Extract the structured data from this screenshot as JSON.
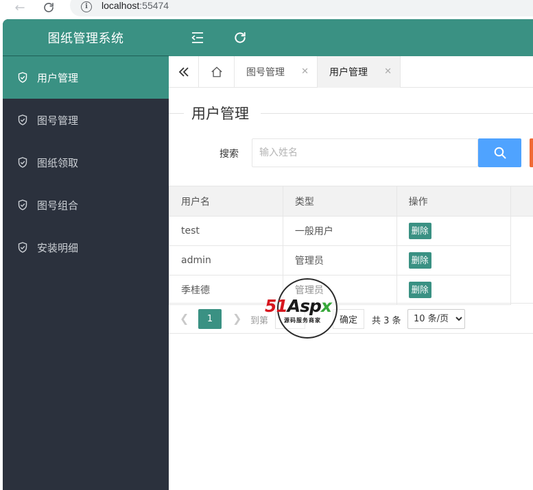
{
  "browser": {
    "url_host": "localhost",
    "url_port": ":55474"
  },
  "app": {
    "title": "图纸管理系统"
  },
  "sidebar": {
    "items": [
      {
        "label": "用户管理",
        "active": true
      },
      {
        "label": "图号管理",
        "active": false
      },
      {
        "label": "图纸领取",
        "active": false
      },
      {
        "label": "图号组合",
        "active": false
      },
      {
        "label": "安装明细",
        "active": false
      }
    ]
  },
  "tabs": [
    {
      "label": "图号管理",
      "active": false
    },
    {
      "label": "用户管理",
      "active": true
    }
  ],
  "page": {
    "title": "用户管理"
  },
  "search": {
    "label": "搜索",
    "placeholder": "输入姓名",
    "value": ""
  },
  "table": {
    "headers": [
      "用户名",
      "类型",
      "操作"
    ],
    "rows": [
      {
        "username": "test",
        "type": "一般用户",
        "action": "删除"
      },
      {
        "username": "admin",
        "type": "管理员",
        "action": "删除"
      },
      {
        "username": "季桂德",
        "type": "管理员",
        "action": "删除"
      }
    ]
  },
  "pagination": {
    "current_page": "1",
    "goto_label": "到第",
    "confirm_label": "确定",
    "total_label": "共 3 条",
    "page_size": "10 条/页"
  },
  "watermark": {
    "brand_51": "51",
    "brand_asp": "Asp",
    "brand_x": "x",
    "subtitle": "源码服务商家"
  },
  "colors": {
    "primary": "#3a9183",
    "sidebar_bg": "#2b313d",
    "search_button": "#4fa3ff",
    "accent_orange": "#f06a35"
  }
}
